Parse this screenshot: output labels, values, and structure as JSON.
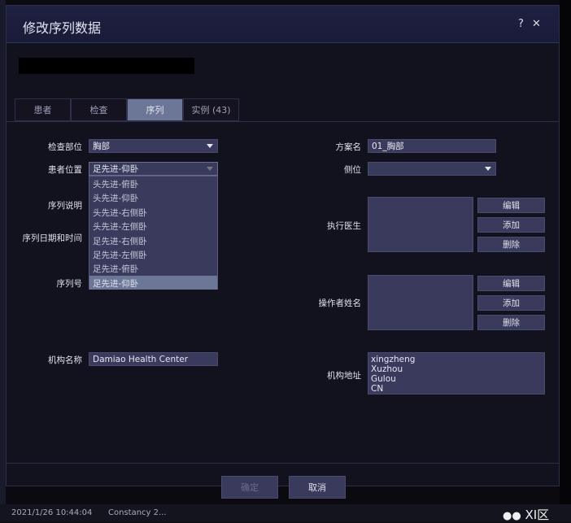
{
  "dialog": {
    "title": "修改序列数据",
    "help": "?",
    "close": "✕"
  },
  "tabs": [
    {
      "label": "患者"
    },
    {
      "label": "检查"
    },
    {
      "label": "序列"
    },
    {
      "label": "实例 (43)"
    }
  ],
  "left": {
    "body_part_label": "检查部位",
    "body_part_value": "胸部",
    "patient_position_label": "患者位置",
    "patient_position_value": "足先进-仰卧",
    "position_options": [
      "头先进-俯卧",
      "头先进-仰卧",
      "头先进-右侧卧",
      "头先进-左侧卧",
      "足先进-右侧卧",
      "足先进-左侧卧",
      "足先进-俯卧",
      "足先进-仰卧"
    ],
    "series_desc_label": "序列说明",
    "series_datetime_label": "序列日期和时间",
    "series_number_label": "序列号",
    "institution_label": "机构名称",
    "institution_value": "Damiao Health Center"
  },
  "right": {
    "protocol_label": "方案名",
    "protocol_value": "01_胸部",
    "laterality_label": "侧位",
    "laterality_value": "",
    "performing_label": "执行医生",
    "operator_label": "操作者姓名",
    "edit": "编辑",
    "add": "添加",
    "delete": "删除",
    "address_label": "机构地址",
    "address_lines": [
      "xingzheng",
      "Xuzhou",
      "Gulou",
      "CN"
    ]
  },
  "footer": {
    "ok": "确定",
    "cancel": "取消"
  },
  "background": {
    "datetime": "2021/1/26 10:44:04",
    "name": "Constancy 2..."
  },
  "watermark": "XI区"
}
